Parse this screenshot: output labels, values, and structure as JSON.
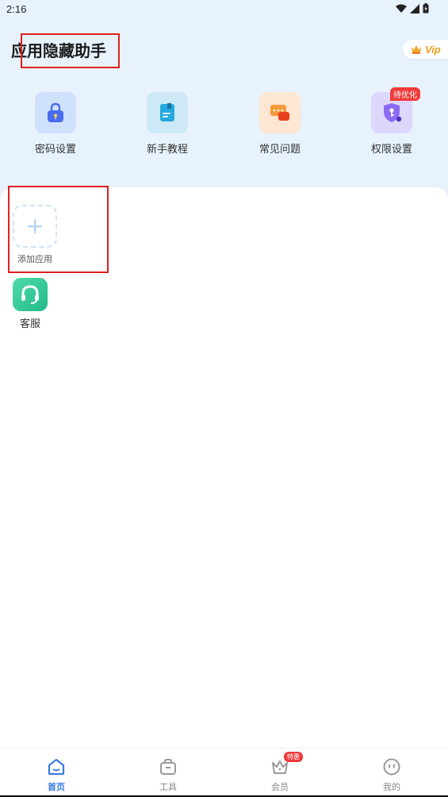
{
  "status_bar": {
    "time": "2:16"
  },
  "header": {
    "title": "应用隐藏助手",
    "vip_label": "Vip"
  },
  "features": [
    {
      "label": "密码设置",
      "icon": "lock-icon"
    },
    {
      "label": "新手教程",
      "icon": "book-icon"
    },
    {
      "label": "常见问题",
      "icon": "chat-bubble-icon"
    },
    {
      "label": "权限设置",
      "icon": "shield-key-icon",
      "badge": "待优化"
    }
  ],
  "apps": {
    "add_label": "添加应用",
    "items": [
      {
        "label": "客服",
        "icon": "headset-icon"
      }
    ]
  },
  "bottom_nav": [
    {
      "label": "首页",
      "icon": "home-icon",
      "active": true
    },
    {
      "label": "工具",
      "icon": "toolbox-icon",
      "active": false
    },
    {
      "label": "会员",
      "icon": "crown-icon",
      "active": false,
      "badge": "特惠"
    },
    {
      "label": "我的",
      "icon": "face-icon",
      "active": false
    }
  ],
  "colors": {
    "header_bg": "#e7f2fd",
    "accent": "#3a7be0",
    "badge": "#ee3b3b",
    "vip": "#f0a020",
    "service": "#22b98a"
  }
}
